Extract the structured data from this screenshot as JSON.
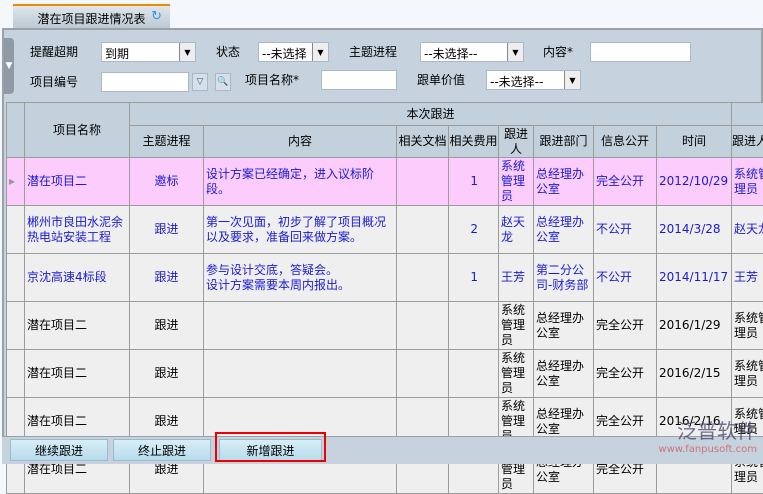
{
  "tab": {
    "title": "潜在项目跟进情况表"
  },
  "filters": {
    "remind_label": "提醒超期",
    "remind_value": "到期",
    "status_label": "状态",
    "status_value": "--未选择",
    "topic_label": "主题进程",
    "topic_value": "--未选择--",
    "content_label": "内容*",
    "project_no_label": "项目编号",
    "project_name_label": "项目名称*",
    "value_label": "跟单价值",
    "value_value": "--未选择--"
  },
  "table": {
    "group_header": "本次跟进",
    "headers": [
      "项目名称",
      "主题进程",
      "内容",
      "相关文档",
      "相关费用",
      "跟进人",
      "跟进部门",
      "信息公开",
      "时间",
      "跟进人"
    ],
    "rows": [
      [
        "潜在项目二",
        "邀标",
        "设计方案已经确定，进入议标阶段。",
        "",
        "1",
        "系统管理员",
        "总经理办公室",
        "完全公开",
        "2012/10/29",
        "系统管理员"
      ],
      [
        "郴州市良田水泥余热电站安装工程",
        "跟进",
        "第一次见面，初步了解了项目概况以及要求，准备回来做方案。",
        "",
        "2",
        "赵天龙",
        "总经理办公室",
        "不公开",
        "2014/3/28",
        "赵天龙"
      ],
      [
        "京沈高速4标段",
        "跟进",
        "参与设计交底，答疑会。\n设计方案需要本周内报出。",
        "",
        "1",
        "王芳",
        "第二分公司-财务部",
        "不公开",
        "2014/11/17",
        "王芳"
      ],
      [
        "潜在项目二",
        "跟进",
        "",
        "",
        "",
        "系统管理员",
        "总经理办公室",
        "完全公开",
        "2016/1/29",
        "系统管理员"
      ],
      [
        "潜在项目二",
        "跟进",
        "",
        "",
        "",
        "系统管理员",
        "总经理办公室",
        "完全公开",
        "2016/2/15",
        "系统管理员"
      ],
      [
        "潜在项目二",
        "跟进",
        "",
        "",
        "",
        "系统管理员",
        "总经理办公室",
        "完全公开",
        "2016/2/16",
        "系统管理员"
      ],
      [
        "潜在项目二",
        "跟进",
        "",
        "",
        "",
        "系统管理员",
        "总经理办公室",
        "完全公开",
        "",
        "系统管理员"
      ]
    ]
  },
  "buttons": {
    "continue": "继续跟进",
    "stop": "终止跟进",
    "add": "新增跟进"
  },
  "watermark": {
    "name": "泛普软件",
    "url": "www.fanpusoft.com"
  }
}
